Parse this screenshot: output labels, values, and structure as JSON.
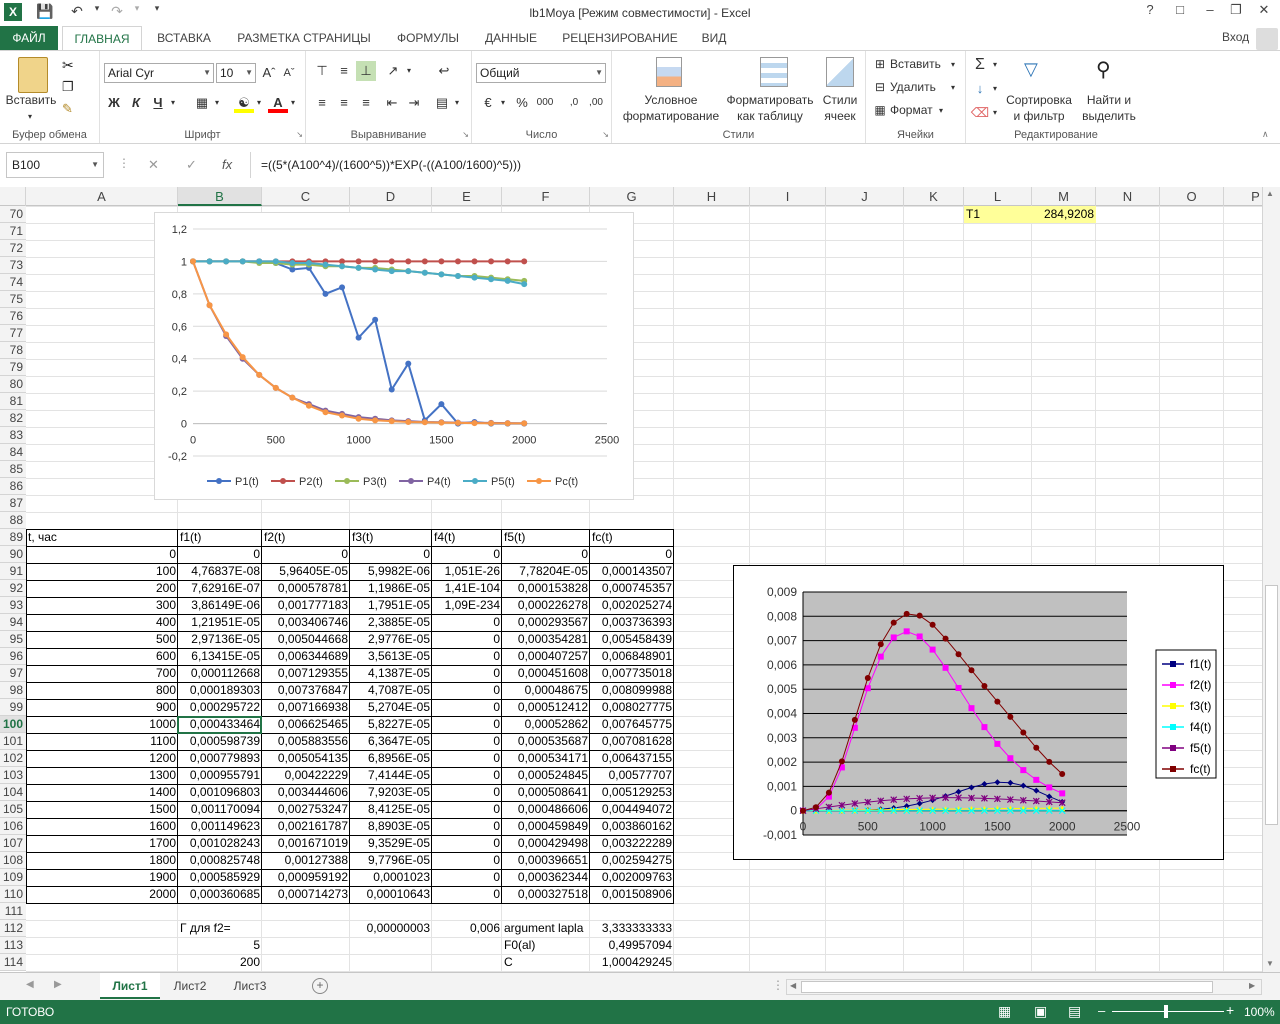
{
  "window": {
    "title": "lb1Moya  [Режим совместимости] - Excel",
    "help": "?",
    "login": "Вход"
  },
  "ribbon": {
    "tabs": [
      "ФАЙЛ",
      "ГЛАВНАЯ",
      "ВСТАВКА",
      "РАЗМЕТКА СТРАНИЦЫ",
      "ФОРМУЛЫ",
      "ДАННЫЕ",
      "РЕЦЕНЗИРОВАНИЕ",
      "ВИД"
    ],
    "paste": "Вставить",
    "clipboard": "Буфер обмена",
    "font_name": "Arial Cyr",
    "font_size": "10",
    "font_group": "Шрифт",
    "bold": "Ж",
    "italic": "К",
    "underline": "Ч",
    "align_group": "Выравнивание",
    "number_format": "Общий",
    "number_group": "Число",
    "cond_format": [
      "Условное",
      "форматирование"
    ],
    "format_table": [
      "Форматировать",
      "как таблицу"
    ],
    "cell_styles": [
      "Стили",
      "ячеек"
    ],
    "styles_group": "Стили",
    "insert": "Вставить",
    "delete": "Удалить",
    "format": "Формат",
    "cells_group": "Ячейки",
    "sort": [
      "Сортировка",
      "и фильтр"
    ],
    "find": [
      "Найти и",
      "выделить"
    ],
    "edit_group": "Редактирование"
  },
  "formula_bar": {
    "name_box": "B100",
    "fx": "fx",
    "formula": "=((5*(A100^4)/(1600^5))*EXP(-((A100/1600)^5)))"
  },
  "columns": [
    "A",
    "B",
    "C",
    "D",
    "E",
    "F",
    "G",
    "H",
    "I",
    "J",
    "K",
    "L",
    "M",
    "N",
    "O",
    "P"
  ],
  "rows_top": [
    "70",
    "71",
    "72",
    "73",
    "74",
    "75",
    "76",
    "77",
    "78",
    "79",
    "80",
    "81",
    "82",
    "83",
    "84",
    "85",
    "86",
    "87",
    "88"
  ],
  "cells_top": {
    "L70": "T1",
    "M70": "284,9208"
  },
  "table": {
    "header": [
      "t, час",
      "f1(t)",
      "f2(t)",
      "f3(t)",
      "f4(t)",
      "f5(t)",
      "fc(t)"
    ],
    "rows": [
      [
        "0",
        "0",
        "0",
        "0",
        "0",
        "0",
        "0"
      ],
      [
        "100",
        "4,76837E-08",
        "5,96405E-05",
        "5,9982E-06",
        "1,051E-26",
        "7,78204E-05",
        "0,000143507"
      ],
      [
        "200",
        "7,62916E-07",
        "0,000578781",
        "1,1986E-05",
        "1,41E-104",
        "0,000153828",
        "0,000745357"
      ],
      [
        "300",
        "3,86149E-06",
        "0,001777183",
        "1,7951E-05",
        "1,09E-234",
        "0,000226278",
        "0,002025274"
      ],
      [
        "400",
        "1,21951E-05",
        "0,003406746",
        "2,3885E-05",
        "0",
        "0,000293567",
        "0,003736393"
      ],
      [
        "500",
        "2,97136E-05",
        "0,005044668",
        "2,9776E-05",
        "0",
        "0,000354281",
        "0,005458439"
      ],
      [
        "600",
        "6,13415E-05",
        "0,006344689",
        "3,5613E-05",
        "0",
        "0,000407257",
        "0,006848901"
      ],
      [
        "700",
        "0,000112668",
        "0,007129355",
        "4,1387E-05",
        "0",
        "0,000451608",
        "0,007735018"
      ],
      [
        "800",
        "0,000189303",
        "0,007376847",
        "4,7087E-05",
        "0",
        "0,00048675",
        "0,008099988"
      ],
      [
        "900",
        "0,000295722",
        "0,007166938",
        "5,2704E-05",
        "0",
        "0,000512412",
        "0,008027775"
      ],
      [
        "1000",
        "0,000433464",
        "0,006625465",
        "5,8227E-05",
        "0",
        "0,00052862",
        "0,007645775"
      ],
      [
        "1100",
        "0,000598739",
        "0,005883556",
        "6,3647E-05",
        "0",
        "0,000535687",
        "0,007081628"
      ],
      [
        "1200",
        "0,000779893",
        "0,005054135",
        "6,8956E-05",
        "0",
        "0,000534171",
        "0,006437155"
      ],
      [
        "1300",
        "0,000955791",
        "0,00422229",
        "7,4144E-05",
        "0",
        "0,000524845",
        "0,00577707"
      ],
      [
        "1400",
        "0,001096803",
        "0,003444606",
        "7,9203E-05",
        "0",
        "0,000508641",
        "0,005129253"
      ],
      [
        "1500",
        "0,001170094",
        "0,002753247",
        "8,4125E-05",
        "0",
        "0,000486606",
        "0,004494072"
      ],
      [
        "1600",
        "0,001149623",
        "0,002161787",
        "8,8903E-05",
        "0",
        "0,000459849",
        "0,003860162"
      ],
      [
        "1700",
        "0,001028243",
        "0,001671019",
        "9,3529E-05",
        "0",
        "0,000429498",
        "0,003222289"
      ],
      [
        "1800",
        "0,000825748",
        "0,00127388",
        "9,7796E-05",
        "0",
        "0,000396651",
        "0,002594275"
      ],
      [
        "1900",
        "0,000585929",
        "0,000959192",
        "0,0001023",
        "0",
        "0,000362344",
        "0,002009763"
      ],
      [
        "2000",
        "0,000360685",
        "0,000714273",
        "0,00010643",
        "0",
        "0,000327518",
        "0,001508906"
      ]
    ]
  },
  "rows_bottom": [
    "89",
    "90",
    "91",
    "92",
    "93",
    "94",
    "95",
    "96",
    "97",
    "98",
    "99",
    "100",
    "101",
    "102",
    "103",
    "104",
    "105",
    "106",
    "107",
    "108",
    "109",
    "110",
    "111",
    "112",
    "113",
    "114"
  ],
  "extra": {
    "B112": "Г для f2=",
    "D112": "0,00000003",
    "E112": "0,006",
    "F112": "argument lapla",
    "G112": "3,333333333",
    "B113": "5",
    "F113": "F0(al)",
    "G113": "0,49957094",
    "B114": "200",
    "F114": "C",
    "G114": "1,000429245"
  },
  "sheets": [
    "Лист1",
    "Лист2",
    "Лист3"
  ],
  "status": {
    "ready": "ГОТОВО",
    "zoom": "100%"
  },
  "chart_data": [
    {
      "type": "line",
      "x": [
        0,
        100,
        200,
        300,
        400,
        500,
        600,
        700,
        800,
        900,
        1000,
        1100,
        1200,
        1300,
        1400,
        1500,
        1600,
        1700,
        1800,
        1900,
        2000
      ],
      "series": [
        {
          "name": "P1(t)",
          "color": "#4472c4",
          "values": [
            1,
            1,
            1,
            1,
            1,
            0.99,
            0.95,
            0.96,
            0.8,
            0.84,
            0.53,
            0.64,
            0.21,
            0.37,
            0.02,
            0.12,
            0,
            0.01,
            0,
            0,
            0
          ]
        },
        {
          "name": "P2(t)",
          "color": "#c0504d",
          "values": [
            1,
            1,
            1,
            1,
            1,
            1,
            1,
            1,
            1,
            1,
            1,
            1,
            1,
            1,
            1,
            1,
            1,
            1,
            1,
            1,
            1
          ]
        },
        {
          "name": "P3(t)",
          "color": "#9bbb59",
          "values": [
            1,
            1,
            1,
            1,
            0.99,
            0.99,
            0.98,
            0.98,
            0.97,
            0.97,
            0.96,
            0.96,
            0.95,
            0.94,
            0.93,
            0.92,
            0.91,
            0.91,
            0.9,
            0.89,
            0.88
          ]
        },
        {
          "name": "P4(t)",
          "color": "#8064a2",
          "values": [
            1,
            0.73,
            0.54,
            0.4,
            0.3,
            0.22,
            0.16,
            0.12,
            0.08,
            0.06,
            0.04,
            0.03,
            0.02,
            0.015,
            0.01,
            0.008,
            0.006,
            0.005,
            0.004,
            0.003,
            0.002
          ]
        },
        {
          "name": "P5(t)",
          "color": "#4bacc6",
          "values": [
            1,
            1,
            1,
            1,
            1,
            1,
            0.99,
            0.99,
            0.98,
            0.97,
            0.96,
            0.95,
            0.94,
            0.94,
            0.93,
            0.92,
            0.91,
            0.9,
            0.89,
            0.88,
            0.86
          ]
        },
        {
          "name": "Pc(t)",
          "color": "#f79646",
          "values": [
            1,
            0.73,
            0.55,
            0.41,
            0.3,
            0.22,
            0.16,
            0.11,
            0.07,
            0.05,
            0.03,
            0.02,
            0.015,
            0.01,
            0.008,
            0.006,
            0.004,
            0.003,
            0.002,
            0.0015,
            0.001
          ]
        }
      ],
      "xlim": [
        0,
        2500
      ],
      "ylim": [
        -0.2,
        1.2
      ],
      "xticks": [
        "0",
        "500",
        "1000",
        "1500",
        "2000",
        "2500"
      ],
      "yticks": [
        "1,2",
        "1",
        "0,8",
        "0,6",
        "0,4",
        "0,2",
        "0",
        "-0,2"
      ],
      "grid": true,
      "legend": "bottom"
    },
    {
      "type": "line",
      "x": [
        0,
        100,
        200,
        300,
        400,
        500,
        600,
        700,
        800,
        900,
        1000,
        1100,
        1200,
        1300,
        1400,
        1500,
        1600,
        1700,
        1800,
        1900,
        2000
      ],
      "series": [
        {
          "name": "f1(t)",
          "color": "#000080",
          "values": [
            0,
            4.77e-08,
            7.63e-07,
            3.86e-06,
            1.22e-05,
            2.97e-05,
            6.13e-05,
            0.000113,
            0.000189,
            0.000296,
            0.000433,
            0.000599,
            0.00078,
            0.000956,
            0.0011,
            0.00117,
            0.00115,
            0.00103,
            0.000826,
            0.000586,
            0.000361
          ]
        },
        {
          "name": "f2(t)",
          "color": "#ff00ff",
          "values": [
            0,
            5.96e-05,
            0.000579,
            0.00178,
            0.00341,
            0.00504,
            0.00634,
            0.00713,
            0.00738,
            0.00717,
            0.00663,
            0.00588,
            0.00505,
            0.00422,
            0.00344,
            0.00275,
            0.00216,
            0.00167,
            0.00127,
            0.000959,
            0.000714
          ]
        },
        {
          "name": "f3(t)",
          "color": "#ffff00",
          "values": [
            0,
            6e-06,
            1.2e-05,
            1.8e-05,
            2.4e-05,
            3e-05,
            3.6e-05,
            4.1e-05,
            4.7e-05,
            5.3e-05,
            5.8e-05,
            6.4e-05,
            6.9e-05,
            7.4e-05,
            7.9e-05,
            8.4e-05,
            8.9e-05,
            9.4e-05,
            9.8e-05,
            0.000102,
            0.000106
          ]
        },
        {
          "name": "f4(t)",
          "color": "#00ffff",
          "values": [
            0,
            0,
            0,
            0,
            0,
            0,
            0,
            0,
            0,
            0,
            0,
            0,
            0,
            0,
            0,
            0,
            0,
            0,
            0,
            0,
            0
          ]
        },
        {
          "name": "f5(t)",
          "color": "#800080",
          "values": [
            0,
            7.78e-05,
            0.000154,
            0.000226,
            0.000294,
            0.000354,
            0.000407,
            0.000452,
            0.000487,
            0.000512,
            0.000529,
            0.000536,
            0.000534,
            0.000525,
            0.000509,
            0.000487,
            0.00046,
            0.000429,
            0.000397,
            0.000362,
            0.000328
          ]
        },
        {
          "name": "fc(t)",
          "color": "#800000",
          "values": [
            0,
            0.000144,
            0.000745,
            0.00203,
            0.00374,
            0.00546,
            0.00685,
            0.00774,
            0.0081,
            0.00803,
            0.00765,
            0.00708,
            0.00644,
            0.00578,
            0.00513,
            0.00449,
            0.00386,
            0.00322,
            0.00259,
            0.00201,
            0.00151
          ]
        }
      ],
      "xlim": [
        0,
        2500
      ],
      "ylim": [
        -0.001,
        0.009
      ],
      "xticks": [
        "0",
        "500",
        "1000",
        "1500",
        "2000",
        "2500"
      ],
      "yticks": [
        "0,009",
        "0,008",
        "0,007",
        "0,006",
        "0,005",
        "0,004",
        "0,003",
        "0,002",
        "0,001",
        "0",
        "-0,001"
      ],
      "grid": true,
      "legend": "right"
    }
  ]
}
